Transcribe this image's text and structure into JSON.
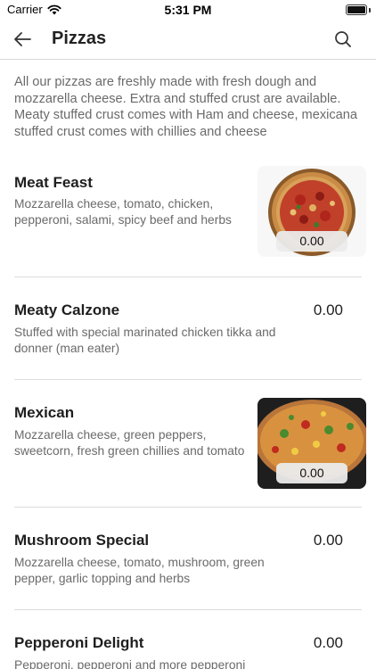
{
  "status_bar": {
    "carrier": "Carrier",
    "time": "5:31 PM"
  },
  "nav": {
    "title": "Pizzas"
  },
  "intro": "All our pizzas are freshly made with fresh dough and mozzarella cheese. Extra and stuffed crust are available. Meaty stuffed crust comes with Ham and cheese, mexicana stuffed crust comes with chillies and cheese",
  "items": [
    {
      "name": "Meat Feast",
      "description": "Mozzarella cheese, tomato, chicken, pepperoni, salami, spicy beef and herbs",
      "price": "0.00"
    },
    {
      "name": "Meaty Calzone",
      "description": "Stuffed with special marinated chicken tikka and donner (man eater)",
      "price": "0.00"
    },
    {
      "name": "Mexican",
      "description": "Mozzarella cheese, green peppers, sweetcorn, fresh green chillies and tomato",
      "price": "0.00"
    },
    {
      "name": "Mushroom Special",
      "description": "Mozzarella cheese, tomato, mushroom, green pepper, garlic topping and herbs",
      "price": "0.00"
    },
    {
      "name": "Pepperoni Delight",
      "description": "Pepperoni, pepperoni and more pepperoni",
      "price": "0.00"
    }
  ]
}
